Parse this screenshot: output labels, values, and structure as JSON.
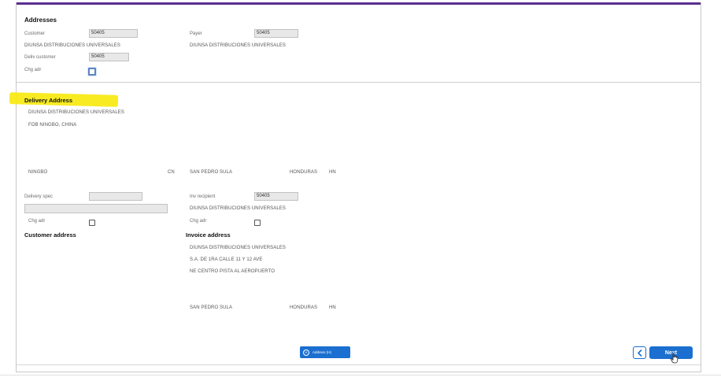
{
  "addresses": {
    "title": "Addresses",
    "customer_label": "Customer",
    "customer_value": "50405",
    "customer_name": "DIUNSA DISTRIBUCIONES UNIVERSALES",
    "payer_label": "Payer",
    "payer_value": "50405",
    "payer_name": "DIUNSA DISTRIBUCIONES UNIVERSALES",
    "deliv_customer_label": "Deliv customer",
    "deliv_customer_value": "50405",
    "chg_adr_label": "Chg adr"
  },
  "delivery": {
    "title": "Delivery Address",
    "name": "DIUNSA DISTRIBUCIONES UNIVERSALES",
    "line2": "FOB NINGBO, CHINA",
    "city": "NINGBO",
    "country": "CN",
    "delivery_spec_label": "Delivery spec",
    "chg_adr_label": "Chg adr"
  },
  "recipient": {
    "city": "SAN PEDRO SULA",
    "country_name": "HONDURAS",
    "country_code": "HN",
    "inv_recipient_label": "Inv recipient",
    "inv_recipient_value": "50405",
    "name": "DIUNSA DISTRIBUCIONES UNIVERSALES",
    "chg_adr_label": "Chg adr"
  },
  "customer_address": {
    "title": "Customer address"
  },
  "invoice_address": {
    "title": "Invoice address",
    "line1": "DIUNSA DISTRIBUCIONES UNIVERSALES",
    "line2": "S.A. DE 1RA CALLE 11 Y 12 AVE",
    "line3": "NE CENTRO PISTA AL AEROPUERTO",
    "city": "SAN PEDRO SULA",
    "country_name": "HONDURAS",
    "country_code": "HN"
  },
  "footer": {
    "address_button_key": "H",
    "address_button_label": "Address (H)",
    "back_icon": "chevron-left-icon",
    "next_label": "Next"
  },
  "colors": {
    "accent": "#1a6fd0",
    "top_bar": "#5b2d8e",
    "highlight": "#f8ea16"
  }
}
